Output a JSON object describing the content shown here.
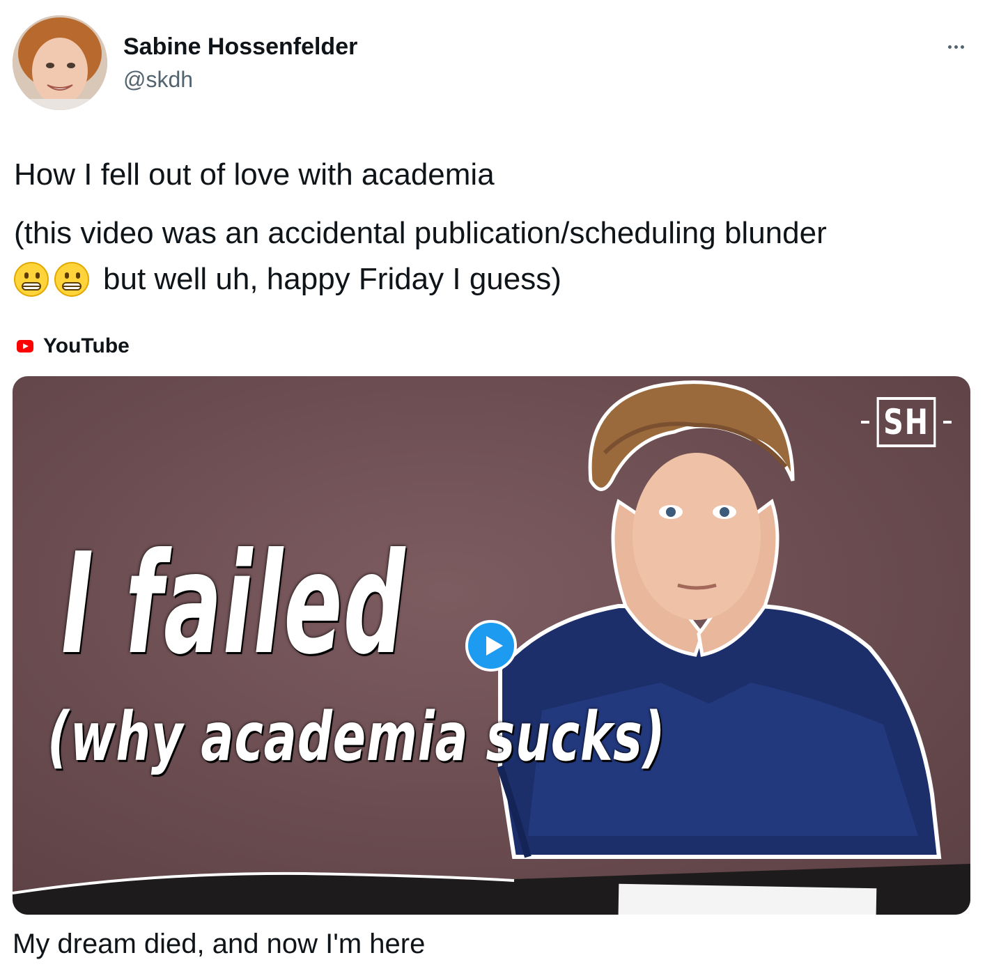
{
  "author": {
    "name": "Sabine Hossenfelder",
    "handle": "@skdh",
    "avatar_icon": "profile-photo"
  },
  "more_icon": "more-options-icon",
  "tweet": {
    "line1": "How I fell out of love with academia",
    "line2": "(this video was an accidental publication/scheduling blunder",
    "line3_emoji": "grimacing-face-emoji x2",
    "line3": "but well uh, happy Friday I guess)"
  },
  "link_card": {
    "source": "YouTube",
    "thumbnail": {
      "headline": "I failed",
      "subline": "(why academia sucks)",
      "channel_logo": "SH",
      "play_icon": "play-icon"
    },
    "title": "My dream died, and now I'm here"
  },
  "colors": {
    "accent": "#1d9bf0",
    "text": "#0f1419",
    "secondary_text": "#536471",
    "youtube_red": "#ff0000",
    "thumb_background": "#6e4f53"
  }
}
